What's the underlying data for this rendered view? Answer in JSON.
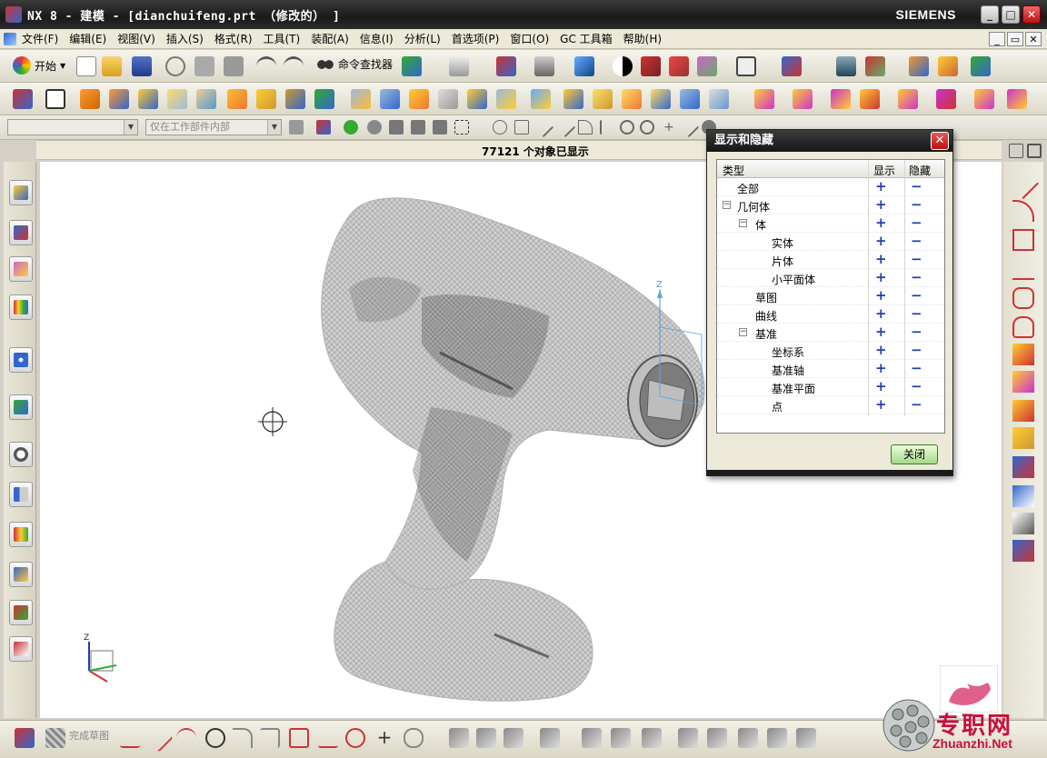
{
  "window": {
    "title": "NX 8 - 建模 - [dianchuifeng.prt  （修改的） ]",
    "brand": "SIEMENS"
  },
  "menu": [
    "文件(F)",
    "编辑(E)",
    "视图(V)",
    "插入(S)",
    "格式(R)",
    "工具(T)",
    "装配(A)",
    "信息(I)",
    "分析(L)",
    "首选项(P)",
    "窗口(O)",
    "GC 工具箱",
    "帮助(H)"
  ],
  "toolbar": {
    "start_label": "开始",
    "finder_label": "命令查找器"
  },
  "selection_bar": {
    "filter_value": "",
    "scope_value": "仅在工作部件内部"
  },
  "status": {
    "message": "77121 个对象已显示"
  },
  "bottom_bar": {
    "finish_sketch_label": "完成草图"
  },
  "dialog": {
    "title": "显示和隐藏",
    "columns": [
      "类型",
      "显示",
      "隐藏"
    ],
    "rows": [
      {
        "label": "全部"
      },
      {
        "label": "几何体"
      },
      {
        "label": "体"
      },
      {
        "label": "实体"
      },
      {
        "label": "片体"
      },
      {
        "label": "小平面体"
      },
      {
        "label": "草图"
      },
      {
        "label": "曲线"
      },
      {
        "label": "基准"
      },
      {
        "label": "坐标系"
      },
      {
        "label": "基准轴"
      },
      {
        "label": "基准平面"
      },
      {
        "label": "点"
      }
    ],
    "show_symbol": "+",
    "hide_symbol": "−",
    "close_label": "关闭"
  },
  "viewport": {
    "axis_z": "Z"
  },
  "watermark": {
    "text_cn": "专职网",
    "url": "Zhuanzhi.Net"
  },
  "colors": {
    "accent_blue": "#1f3fb0",
    "model_gray": "#c7c7c7",
    "watermark_red": "#c8103a"
  }
}
